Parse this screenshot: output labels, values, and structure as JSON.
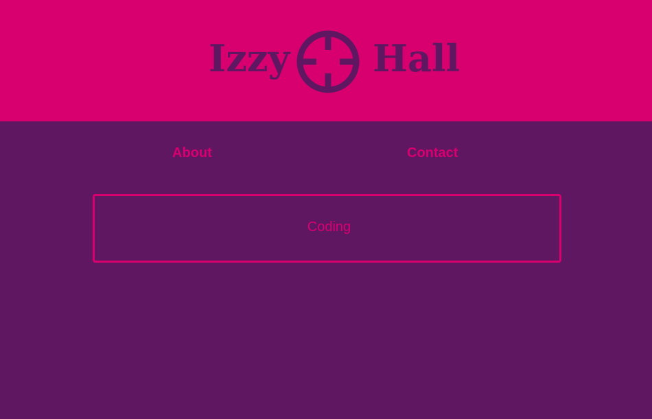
{
  "header": {
    "logo_first": "Izzy",
    "logo_last": "Hall",
    "logo_icon": "crosshair-icon"
  },
  "nav": {
    "items": [
      {
        "label": "About"
      },
      {
        "label": "Contact"
      }
    ]
  },
  "main": {
    "project_label": "Coding"
  },
  "colors": {
    "header_bg": "#d8006f",
    "body_bg": "#5f1762",
    "accent": "#d8006f"
  }
}
